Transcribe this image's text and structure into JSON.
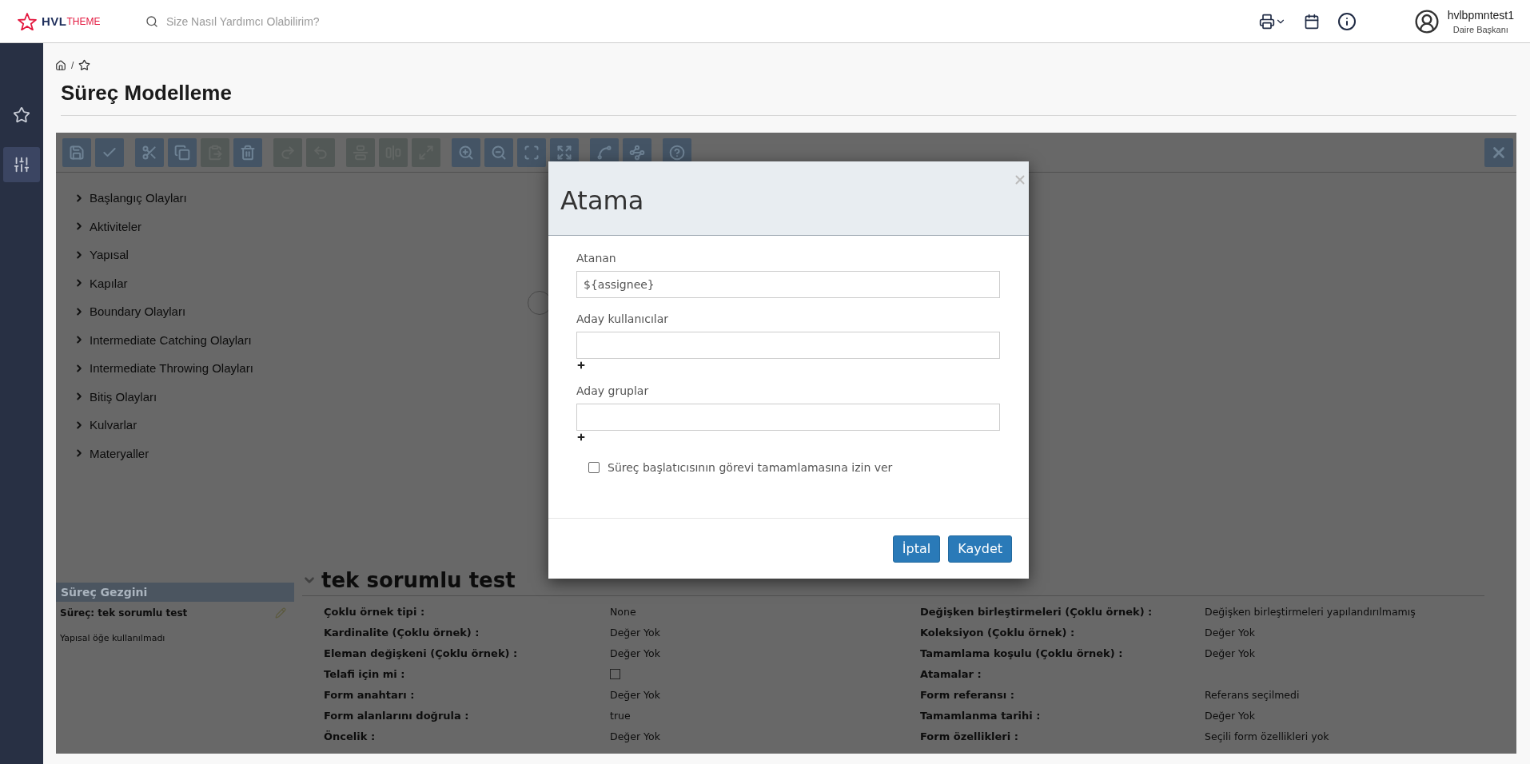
{
  "header": {
    "logo": {
      "primary": "HVL",
      "secondary": "THEME"
    },
    "search": {
      "placeholder": "Size Nasıl Yardımcı Olabilirim?"
    },
    "user": {
      "name": "hvlbpmntest1",
      "role": "Daire Başkanı"
    }
  },
  "sidebar": {
    "items": [
      {
        "kind": "favorites",
        "selected": false
      },
      {
        "kind": "process-model",
        "selected": true
      }
    ]
  },
  "breadcrumb": {
    "separator": "/"
  },
  "page_title": "Süreç Modelleme",
  "editor": {
    "toolbar": {
      "groups": [
        [
          {
            "kind": "save",
            "disabled": false
          },
          {
            "kind": "validate",
            "disabled": false
          }
        ],
        [
          {
            "kind": "cut",
            "disabled": false
          },
          {
            "kind": "copy",
            "disabled": false
          },
          {
            "kind": "paste",
            "disabled": true
          },
          {
            "kind": "delete",
            "disabled": false
          }
        ],
        [
          {
            "kind": "redo",
            "disabled": true
          },
          {
            "kind": "undo",
            "disabled": true
          }
        ],
        [
          {
            "kind": "align-vertical",
            "disabled": true
          },
          {
            "kind": "align-horizontal",
            "disabled": true
          },
          {
            "kind": "same-size",
            "disabled": true
          }
        ],
        [
          {
            "kind": "zoom-in",
            "disabled": false
          },
          {
            "kind": "zoom-out",
            "disabled": false
          },
          {
            "kind": "zoom-actual",
            "disabled": false
          },
          {
            "kind": "zoom-fit",
            "disabled": false
          }
        ],
        [
          {
            "kind": "bendpoint-add",
            "disabled": false
          },
          {
            "kind": "bendpoint-remove",
            "disabled": false
          }
        ],
        [
          {
            "kind": "help",
            "disabled": false
          }
        ]
      ]
    },
    "palette": [
      {
        "label": "Başlangıç Olayları"
      },
      {
        "label": "Aktiviteler"
      },
      {
        "label": "Yapısal"
      },
      {
        "label": "Kapılar"
      },
      {
        "label": "Boundary Olayları"
      },
      {
        "label": "Intermediate Catching Olayları"
      },
      {
        "label": "Intermediate Throwing Olayları"
      },
      {
        "label": "Bitiş Olayları"
      },
      {
        "label": "Kulvarlar"
      },
      {
        "label": "Materyaller"
      }
    ],
    "navigator": {
      "title": "Süreç Gezgini",
      "process": "Süreç: tek sorumlu test",
      "note": "Yapısal öğe kullanılmadı"
    },
    "properties": {
      "title": "tek sorumlu test",
      "expanded": true,
      "left": [
        {
          "kind": "text",
          "label": "Çoklu örnek tipi :",
          "value": "None"
        },
        {
          "kind": "text",
          "label": "Kardinalite (Çoklu örnek) :",
          "value": "Değer Yok"
        },
        {
          "kind": "text",
          "label": "Eleman değişkeni (Çoklu örnek) :",
          "value": "Değer Yok"
        },
        {
          "kind": "checkbox",
          "label": "Telafi için mi :",
          "checked": false
        },
        {
          "kind": "text",
          "label": "Form anahtarı :",
          "value": "Değer Yok"
        },
        {
          "kind": "text",
          "label": "Form alanlarını doğrula :",
          "value": "true"
        },
        {
          "kind": "text",
          "label": "Öncelik :",
          "value": "Değer Yok"
        }
      ],
      "right": [
        {
          "kind": "text",
          "label": "Değişken birleştirmeleri (Çoklu örnek) :",
          "value": "Değişken birleştirmeleri yapılandırılmamış"
        },
        {
          "kind": "text",
          "label": "Koleksiyon (Çoklu örnek) :",
          "value": "Değer Yok"
        },
        {
          "kind": "text",
          "label": "Tamamlama koşulu (Çoklu örnek) :",
          "value": "Değer Yok"
        },
        {
          "kind": "text",
          "label": "Atamalar :"
        },
        {
          "kind": "text",
          "label": "Form referansı :",
          "value": "Referans seçilmedi"
        },
        {
          "kind": "text",
          "label": "Tamamlanma tarihi :",
          "value": "Değer Yok"
        },
        {
          "kind": "text",
          "label": "Form özellikleri :",
          "value": "Seçili form özellikleri yok"
        }
      ]
    }
  },
  "dialog": {
    "title": "Atama",
    "fields": [
      {
        "label": "Atanan",
        "value": "${assignee}",
        "addable": false
      },
      {
        "label": "Aday kullanıcılar",
        "addable": true
      },
      {
        "label": "Aday gruplar",
        "addable": true
      }
    ],
    "checkbox": {
      "label": "Süreç başlatıcısının görevi tamamlamasına izin ver",
      "checked": false
    },
    "buttons": [
      {
        "label": "İptal"
      },
      {
        "label": "Kaydet"
      }
    ]
  }
}
